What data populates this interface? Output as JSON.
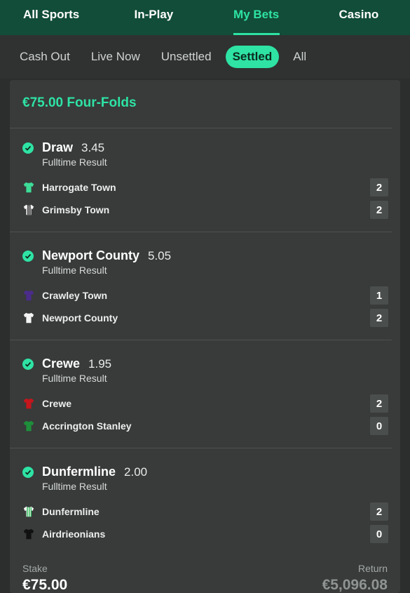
{
  "nav": {
    "items": [
      {
        "label": "All Sports"
      },
      {
        "label": "In-Play"
      },
      {
        "label": "My Bets"
      },
      {
        "label": "Casino"
      }
    ],
    "active": "My Bets"
  },
  "subtabs": {
    "items": [
      {
        "label": "Cash Out"
      },
      {
        "label": "Live Now"
      },
      {
        "label": "Unsettled"
      },
      {
        "label": "Settled"
      },
      {
        "label": "All"
      }
    ],
    "active": "Settled"
  },
  "bet": {
    "title": "€75.00 Four-Folds",
    "selections": [
      {
        "name": "Draw",
        "odds": "3.45",
        "market": "Fulltime Result",
        "teams": [
          {
            "name": "Harrogate Town",
            "score": "2",
            "kit": "kit-harrogate-icon"
          },
          {
            "name": "Grimsby Town",
            "score": "2",
            "kit": "kit-grimsby-icon"
          }
        ]
      },
      {
        "name": "Newport County",
        "odds": "5.05",
        "market": "Fulltime Result",
        "teams": [
          {
            "name": "Crawley Town",
            "score": "1",
            "kit": "kit-crawley-icon"
          },
          {
            "name": "Newport County",
            "score": "2",
            "kit": "kit-newport-icon"
          }
        ]
      },
      {
        "name": "Crewe",
        "odds": "1.95",
        "market": "Fulltime Result",
        "teams": [
          {
            "name": "Crewe",
            "score": "2",
            "kit": "kit-crewe-icon"
          },
          {
            "name": "Accrington Stanley",
            "score": "0",
            "kit": "kit-accrington-icon"
          }
        ]
      },
      {
        "name": "Dunfermline",
        "odds": "2.00",
        "market": "Fulltime Result",
        "teams": [
          {
            "name": "Dunfermline",
            "score": "2",
            "kit": "kit-dunfermline-icon"
          },
          {
            "name": "Airdrieonians",
            "score": "0",
            "kit": "kit-airdrieonians-icon"
          }
        ]
      }
    ],
    "stake_label": "Stake",
    "stake_value": "€75.00",
    "return_label": "Return",
    "return_value": "€5,096.08"
  },
  "colors": {
    "accent": "#2ee3a4",
    "header_bg": "#114d38",
    "card_bg": "#383b3a"
  }
}
